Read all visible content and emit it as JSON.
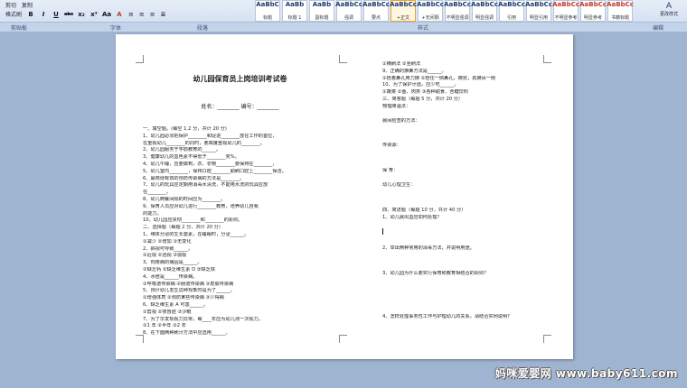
{
  "ribbon": {
    "clipboard_items": [
      "剪切",
      "复制",
      "格式刷"
    ],
    "font_buttons": [
      "B",
      "I",
      "U",
      "abc",
      "x₂",
      "x²",
      "Aa",
      "A"
    ],
    "styles": [
      {
        "sample": "AaBbC",
        "label": "标题"
      },
      {
        "sample": "AaBb",
        "label": "标题 1"
      },
      {
        "sample": "AaBb",
        "label": "副标题"
      },
      {
        "sample": "AaBbCc",
        "label": "强调"
      },
      {
        "sample": "AaBbCc",
        "label": "要点"
      },
      {
        "sample": "AaBbCc",
        "label": "+正文"
      },
      {
        "sample": "AaBbCc",
        "label": "+无间隔"
      },
      {
        "sample": "AaBbCc",
        "label": "不明显强调"
      },
      {
        "sample": "AaBbCc",
        "label": "明显强调"
      },
      {
        "sample": "AaBbCc",
        "label": "引用"
      },
      {
        "sample": "AaBbCc",
        "label": "明显引用"
      },
      {
        "sample": "AaBbCc",
        "label": "不明显参考"
      },
      {
        "sample": "AaBbCc",
        "label": "明显参考"
      },
      {
        "sample": "AaBbCc",
        "label": "书籍标题"
      }
    ],
    "change_styles": "更改样式",
    "groups": {
      "clipboard": "剪贴板",
      "font": "字体",
      "paragraph": "段落",
      "styles": "样式",
      "editing": "编辑"
    }
  },
  "document": {
    "title": "幼儿园保育员上岗培训考试卷",
    "name_line": "姓名：________        编号：________",
    "left_lines": [
      "一、填空题。(每空 1.2 分，共计 20 分)",
      "1、幼儿园必须把保护________和促进________放在工作的首位，",
      "在重视幼儿________的同时，要高度重视幼儿的________。",
      "2、幼儿园服务于学前教育的______。",
      "3、健康幼儿的血色素不得低于________克%。",
      "4、幼儿午睡，应要做到，衣、衣物________要保持在________，",
      "5、幼儿室内________，保持口腔________勤刷口腔上________保洁。",
      "6、最简便有效的预防传染病的方法是________。",
      "7、幼儿的玩具应定期用消毒水清洗，不能用水洗的玩具应放",
      "在________。",
      "8、幼儿两餐间隔的时间应为________。",
      "9、保育人员应对幼儿进行________教育，培养幼儿自我",
      "的能力。",
      "10、幼儿园应贯彻________和________的原则。",
      "二、选择题（每题 2 分，共计 20 分）",
      "1、维体分泌的生长激素，在睡眠时，分泌______。",
      "①减少   ②增加   ③无变化",
      "2、斜视可导致______。",
      "①近视   ②远视   ③弱视",
      "3、佝偻病的病因是______。",
      "①缺乏钙   ②缺乏维生素 D   ③缺乏铁",
      "4、水痘是______传染病。",
      "①呼吸道传染病   ②肠道传染病   ③皮肤传染病",
      "5、预计幼儿发生这种现象时是为了______。",
      "①增强体质   ②预防某些传染病   ③少得病",
      "6、缺乏维生素 A 可患______。",
      "①剪视   ②夜盲症   ③沙眼",
      "7、为了早发现视力异常，每____年应为幼儿测一次视力。",
      "①1 年   ②半年   ③2 年",
      "8、在下面两种刷牙方法中应选用______。"
    ],
    "right_top_lines": [
      "①横刷法   ②竖刷法",
      "9、正确的擤鼻方法是______。",
      "①捂着鼻孔用力擤   ②捂住一侧鼻孔，擤完，再擤另一侧",
      "10、为了保护牙齿，应少吃______。",
      "①蔬菜   ②鱼、肉类   ③各种甜食、含糖饮料",
      "三、简答题（每题 5 分，共计 20 分）",
      "物理降温法："
    ],
    "right_mid_lines": [
      "晨间检查的方法：",
      "传染源：",
      "保  育：",
      "幼儿心理卫生：",
      "四、简述题（每题 10 分，共计 40 分）",
      "1、幼儿晨出血应如何处理？",
      "2、举出两种常用的消毒方法，并说明用途。",
      "3、幼儿园为什么要实行保育和教育相结合的原则？",
      "4、怎样处理事务性工作与护理幼儿的关系，请结合实例说明？"
    ]
  },
  "watermark": "妈咪爱婴网 www.baby611.com"
}
